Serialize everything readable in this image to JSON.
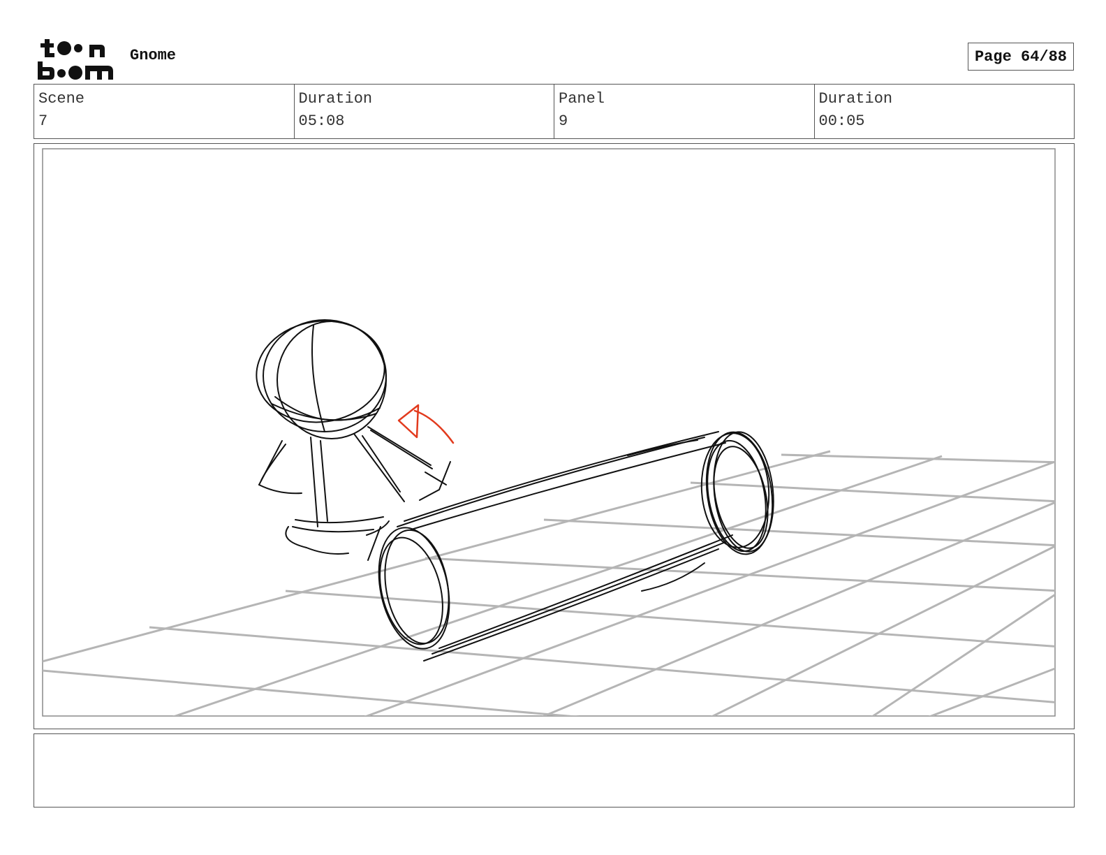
{
  "header": {
    "brand_logo": "toon-boom-logo",
    "project_title": "Gnome",
    "page_indicator": "Page 64/88"
  },
  "info": {
    "scene_label": "Scene",
    "scene_value": "7",
    "scene_duration_label": "Duration",
    "scene_duration_value": "05:08",
    "panel_label": "Panel",
    "panel_value": "9",
    "panel_duration_label": "Duration",
    "panel_duration_value": "00:05"
  },
  "panel": {
    "content": "rough sketch drawing",
    "stroke_color": "#111111",
    "grid_color": "#b5b5b5",
    "arrow_color": "#e23a1d"
  },
  "notes": {
    "text": ""
  }
}
